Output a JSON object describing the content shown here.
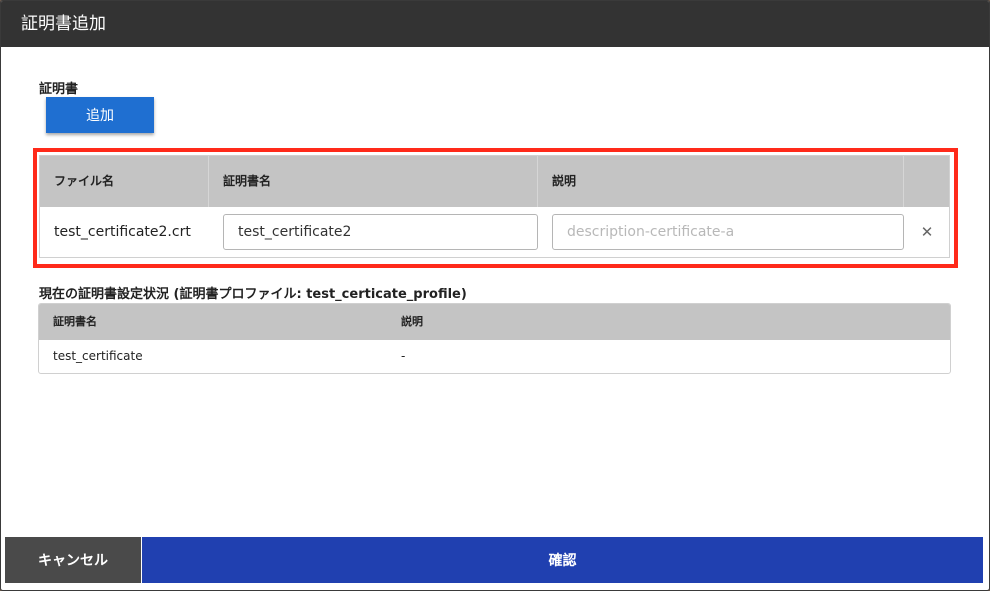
{
  "dialog": {
    "title": "証明書追加"
  },
  "certificate_section": {
    "label": "証明書",
    "add_button_label": "追加"
  },
  "new_certificates_table": {
    "columns": [
      "ファイル名",
      "証明書名",
      "説明",
      ""
    ],
    "rows": [
      {
        "file_name": "test_certificate2.crt",
        "certificate_name_value": "test_certificate2",
        "description_value": "",
        "description_placeholder": "description-certificate-a",
        "remove_icon": "close-icon",
        "remove_glyph": "✕"
      }
    ],
    "highlight_color": "#ff2a1a"
  },
  "current_status": {
    "heading": "現在の証明書設定状況 (証明書プロファイル: test_certicate_profile)",
    "columns": [
      "証明書名",
      "説明"
    ],
    "rows": [
      {
        "certificate_name": "test_certificate",
        "description": "-"
      }
    ]
  },
  "footer": {
    "cancel_label": "キャンセル",
    "confirm_label": "確認"
  },
  "colors": {
    "titlebar": "#333333",
    "add_button": "#1f6fd1",
    "cancel_button": "#4a4a4a",
    "confirm_button": "#2040b0",
    "table_header": "#c4c4c4"
  }
}
